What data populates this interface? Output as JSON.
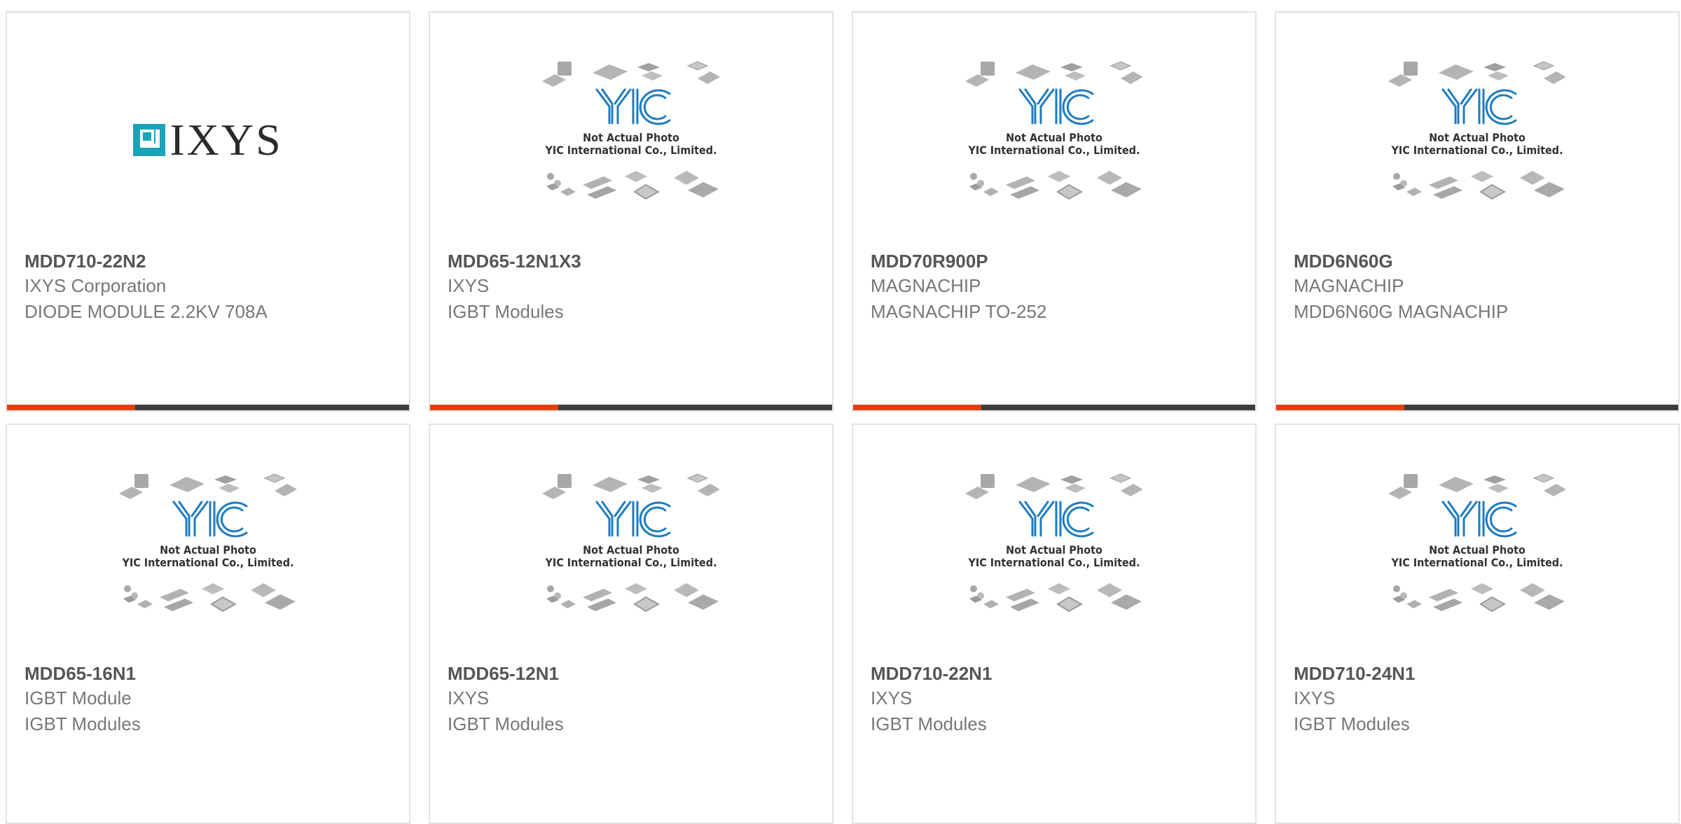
{
  "products": [
    {
      "part": "MDD710-22N2",
      "maker": "IXYS Corporation",
      "desc": "DIODE MODULE 2.2KV 708A",
      "image": "ixys-logo",
      "logo_text": "IXYS"
    },
    {
      "part": "MDD65-12N1X3",
      "maker": "IXYS",
      "desc": "IGBT Modules",
      "image": "yic-placeholder"
    },
    {
      "part": "MDD70R900P",
      "maker": "MAGNACHIP",
      "desc": "MAGNACHIP TO-252",
      "image": "yic-placeholder"
    },
    {
      "part": "MDD6N60G",
      "maker": "MAGNACHIP",
      "desc": "MDD6N60G MAGNACHIP",
      "image": "yic-placeholder"
    },
    {
      "part": "MDD65-16N1",
      "maker": "IGBT Module",
      "desc": "IGBT Modules",
      "image": "yic-placeholder"
    },
    {
      "part": "MDD65-12N1",
      "maker": "IXYS",
      "desc": "IGBT Modules",
      "image": "yic-placeholder"
    },
    {
      "part": "MDD710-22N1",
      "maker": "IXYS",
      "desc": "IGBT Modules",
      "image": "yic-placeholder"
    },
    {
      "part": "MDD710-24N1",
      "maker": "IXYS",
      "desc": "IGBT Modules",
      "image": "yic-placeholder"
    }
  ],
  "placeholder": {
    "line1": "Not Actual Photo",
    "line2": "YIC International Co., Limited."
  },
  "colors": {
    "accent": "#e04010",
    "bar": "#3d3d3d",
    "yic_blue": "#1c7cc0",
    "ixys_teal": "#1aa3b8"
  }
}
